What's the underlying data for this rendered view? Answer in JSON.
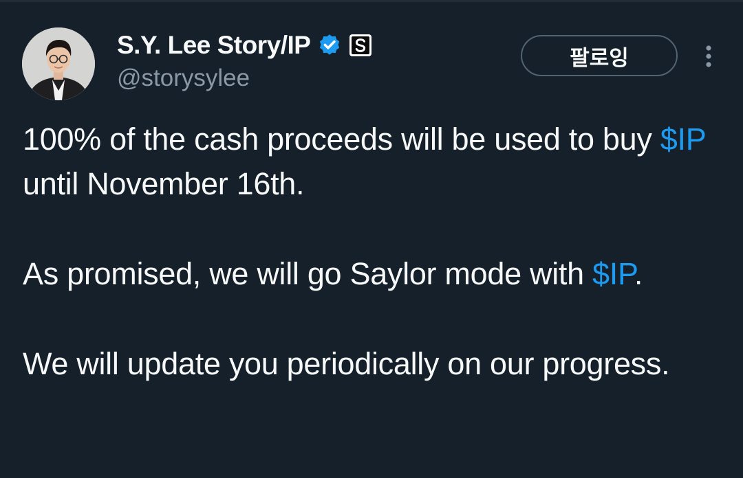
{
  "author": {
    "display_name": "S.Y. Lee Story/IP",
    "handle": "@storysylee",
    "verified_badge_icon": "verified-checkmark-icon",
    "affiliate_badge_icon": "story-protocol-logo-icon",
    "badge_color": "#1d9bf0"
  },
  "actions": {
    "follow_label": "팔로잉",
    "more_icon": "more-vertical-icon"
  },
  "tweet": {
    "paragraphs": [
      {
        "before": "100% of the cash proceeds will be used to buy ",
        "cashtag": "$IP",
        "after": " until November 16th."
      },
      {
        "before": "As promised, we will go Saylor mode with ",
        "cashtag": "$IP",
        "after": "."
      },
      {
        "text": "We will update you periodically on our progress."
      }
    ]
  },
  "colors": {
    "background": "#15202b",
    "text": "#f7f9f9",
    "secondary_text": "#8b98a5",
    "link": "#1d9bf0",
    "border": "#536471"
  }
}
